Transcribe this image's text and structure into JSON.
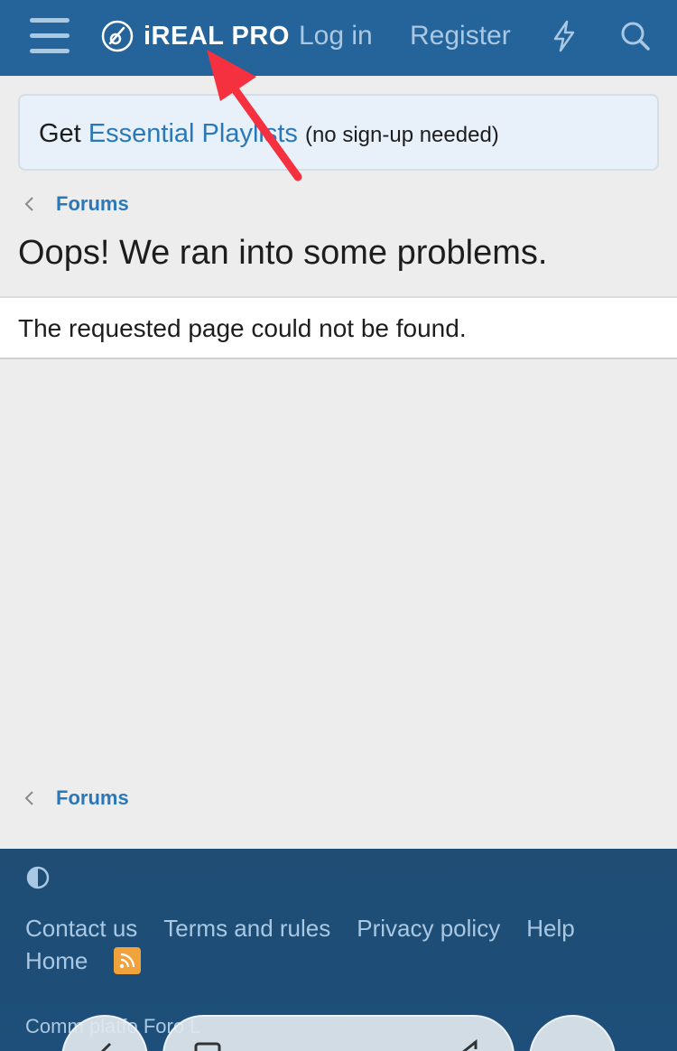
{
  "header": {
    "logo_text": "iREAL PRO",
    "login_label": "Log in",
    "register_label": "Register",
    "icons": [
      "menu-icon",
      "ireal-logo-icon",
      "lightning-icon",
      "search-icon"
    ]
  },
  "notice": {
    "prefix": "Get ",
    "link": "Essential Playlists",
    "suffix": "(no sign-up needed)"
  },
  "breadcrumb": {
    "label": "Forums"
  },
  "error": {
    "title": "Oops! We ran into some problems.",
    "message": "The requested page could not be found."
  },
  "footer": {
    "links_row1": [
      "Contact us",
      "Terms and rules",
      "Privacy policy",
      "Help"
    ],
    "links_row2": [
      "Home"
    ],
    "copyright": "Comm      platfo                                              Foro L"
  },
  "colors": {
    "header": "#24649a",
    "link": "#2b78b8",
    "footer": "#1f4d74",
    "accent_rss": "#f2a23a",
    "annotation_arrow": "#f5303f"
  }
}
